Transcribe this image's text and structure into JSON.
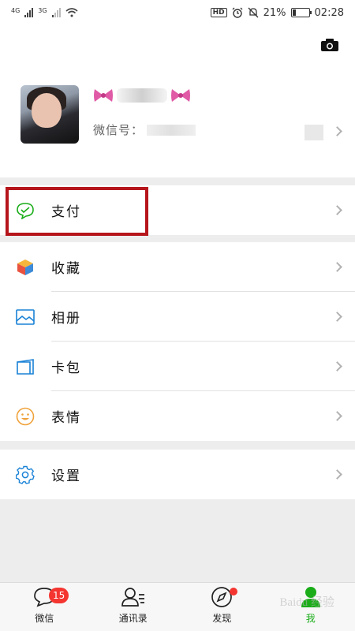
{
  "status_bar": {
    "net1": "4G",
    "net2": "3G",
    "hd": "HD",
    "battery_text": "21%",
    "battery_level": 0.21,
    "time": "02:28"
  },
  "profile": {
    "wechat_id_label": "微信号："
  },
  "menu": {
    "pay": "支付",
    "favorites": "收藏",
    "album": "相册",
    "cards": "卡包",
    "stickers": "表情",
    "settings": "设置"
  },
  "tabs": [
    {
      "label": "微信",
      "badge": "15"
    },
    {
      "label": "通讯录"
    },
    {
      "label": "发现"
    },
    {
      "label": "我"
    }
  ],
  "watermark": "Baidu 经验",
  "colors": {
    "accent": "#1aad19",
    "badge": "#f43530",
    "highlight": "#b5151b",
    "icon_blue": "#1a82d6"
  }
}
